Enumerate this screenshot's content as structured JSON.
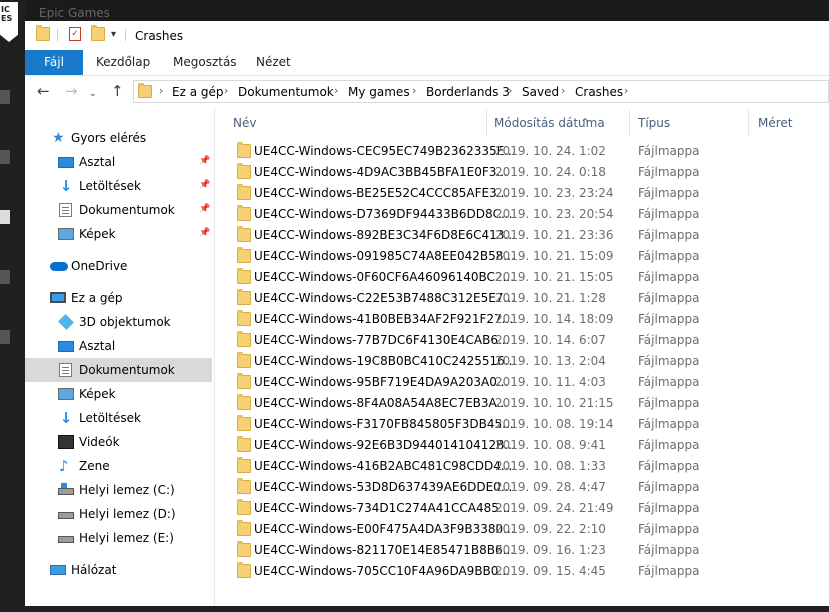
{
  "left_app": {
    "logo_text": "IC\nES"
  },
  "window": {
    "title_behind": "Epic Games",
    "title": "Crashes",
    "ribbon_tabs": [
      "Fájl",
      "Kezdőlap",
      "Megosztás",
      "Nézet"
    ],
    "breadcrumb": [
      "Ez a gép",
      "Dokumentumok",
      "My games",
      "Borderlands 3",
      "Saved",
      "Crashes"
    ]
  },
  "nav_pane": {
    "quick_access": {
      "label": "Gyors elérés",
      "items": [
        "Asztal",
        "Letöltések",
        "Dokumentumok",
        "Képek"
      ]
    },
    "onedrive": "OneDrive",
    "this_pc": {
      "label": "Ez a gép",
      "items": [
        "3D objektumok",
        "Asztal",
        "Dokumentumok",
        "Képek",
        "Letöltések",
        "Videók",
        "Zene",
        "Helyi lemez (C:)",
        "Helyi lemez (D:)",
        "Helyi lemez (E:)"
      ]
    },
    "network": "Hálózat"
  },
  "columns": {
    "name": "Név",
    "date": "Módosítás dátuma",
    "type": "Típus",
    "size": "Méret"
  },
  "files": [
    {
      "name": "UE4CC-Windows-CEC95EC749B2362335E...",
      "date": "2019. 10. 24. 1:02",
      "type": "Fájlmappa"
    },
    {
      "name": "UE4CC-Windows-4D9AC3BB45BFA1E0F3...",
      "date": "2019. 10. 24. 0:18",
      "type": "Fájlmappa"
    },
    {
      "name": "UE4CC-Windows-BE25E52C4CCC85AFE3...",
      "date": "2019. 10. 23. 23:24",
      "type": "Fájlmappa"
    },
    {
      "name": "UE4CC-Windows-D7369DF94433B6DD8C...",
      "date": "2019. 10. 23. 20:54",
      "type": "Fájlmappa"
    },
    {
      "name": "UE4CC-Windows-892BE3C34F6D8E6C413...",
      "date": "2019. 10. 21. 23:36",
      "type": "Fájlmappa"
    },
    {
      "name": "UE4CC-Windows-091985C74A8EE042B58...",
      "date": "2019. 10. 21. 15:09",
      "type": "Fájlmappa"
    },
    {
      "name": "UE4CC-Windows-0F60CF6A46096140BC2...",
      "date": "2019. 10. 21. 15:05",
      "type": "Fájlmappa"
    },
    {
      "name": "UE4CC-Windows-C22E53B7488C312E5E7...",
      "date": "2019. 10. 21. 1:28",
      "type": "Fájlmappa"
    },
    {
      "name": "UE4CC-Windows-41B0BEB34AF2F921F27...",
      "date": "2019. 10. 14. 18:09",
      "type": "Fájlmappa"
    },
    {
      "name": "UE4CC-Windows-77B7DC6F4130E4CAB6...",
      "date": "2019. 10. 14. 6:07",
      "type": "Fájlmappa"
    },
    {
      "name": "UE4CC-Windows-19C8B0BC410C2425516...",
      "date": "2019. 10. 13. 2:04",
      "type": "Fájlmappa"
    },
    {
      "name": "UE4CC-Windows-95BF719E4DA9A203A0...",
      "date": "2019. 10. 11. 4:03",
      "type": "Fájlmappa"
    },
    {
      "name": "UE4CC-Windows-8F4A08A54A8EC7EB3A...",
      "date": "2019. 10. 10. 21:15",
      "type": "Fájlmappa"
    },
    {
      "name": "UE4CC-Windows-F3170FB845805F3DB45...",
      "date": "2019. 10. 08. 19:14",
      "type": "Fájlmappa"
    },
    {
      "name": "UE4CC-Windows-92E6B3D94401410412B...",
      "date": "2019. 10. 08. 9:41",
      "type": "Fájlmappa"
    },
    {
      "name": "UE4CC-Windows-416B2ABC481C98CDD4...",
      "date": "2019. 10. 08. 1:33",
      "type": "Fájlmappa"
    },
    {
      "name": "UE4CC-Windows-53D8D637439AE6DDE0...",
      "date": "2019. 09. 28. 4:47",
      "type": "Fájlmappa"
    },
    {
      "name": "UE4CC-Windows-734D1C274A41CCA485...",
      "date": "2019. 09. 24. 21:49",
      "type": "Fájlmappa"
    },
    {
      "name": "UE4CC-Windows-E00F475A4DA3F9B3380...",
      "date": "2019. 09. 22. 2:10",
      "type": "Fájlmappa"
    },
    {
      "name": "UE4CC-Windows-821170E14E85471B8B6...",
      "date": "2019. 09. 16. 1:23",
      "type": "Fájlmappa"
    },
    {
      "name": "UE4CC-Windows-705CC10F4A96DA9BB0...",
      "date": "2019. 09. 15. 4:45",
      "type": "Fájlmappa"
    }
  ]
}
